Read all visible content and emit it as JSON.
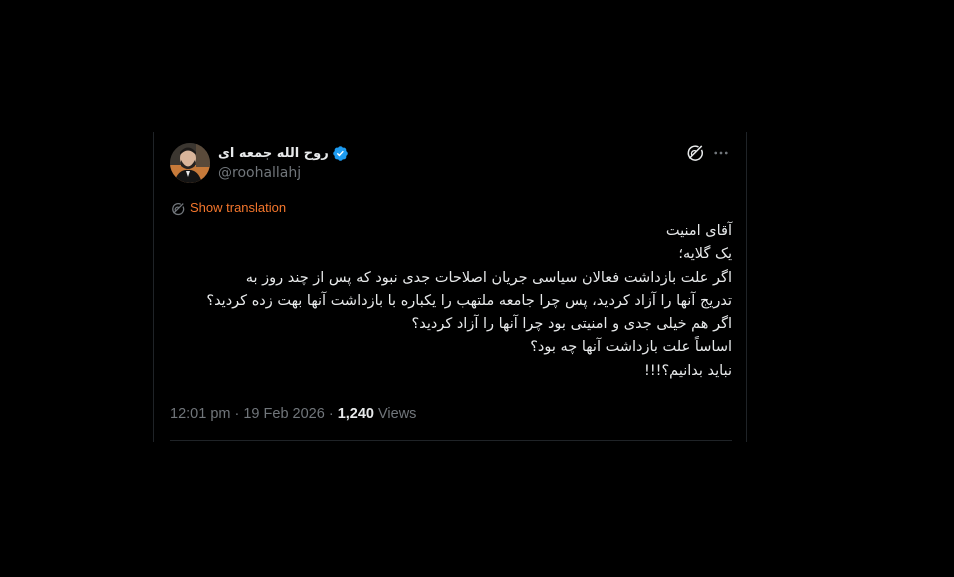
{
  "tweet": {
    "author": {
      "name": "روح الله جمعه ای",
      "handle": "@roohallahj",
      "verified": true,
      "verified_color": "#1d9bf0"
    },
    "show_translation_label": "Show translation",
    "accent_color": "#f4762c",
    "text_lines": [
      "آقای امنیت",
      "یک گلایه؛",
      "اگر علت بازداشت فعالان سیاسی جریان اصلاحات جدی نبود که پس از چند روز به",
      "تدریج آنها را آزاد کردید، پس چرا جامعه ملتهب را یکباره با بازداشت آنها بهت زده کردید؟",
      "اگر هم خیلی جدی و امنیتی بود چرا آنها را آزاد کردید؟",
      "اساساً علت بازداشت آنها چه بود؟",
      "نباید بدانیم؟!!!"
    ],
    "time": "12:01 pm",
    "date": "19 Feb 2026",
    "separator": " · ",
    "views_count": "1,240",
    "views_label": "Views"
  },
  "icons": {
    "avatar": "avatar-photo",
    "verified": "verified-badge-icon",
    "grok": "grok-icon",
    "more": "more-icon",
    "translate": "translate-icon"
  }
}
